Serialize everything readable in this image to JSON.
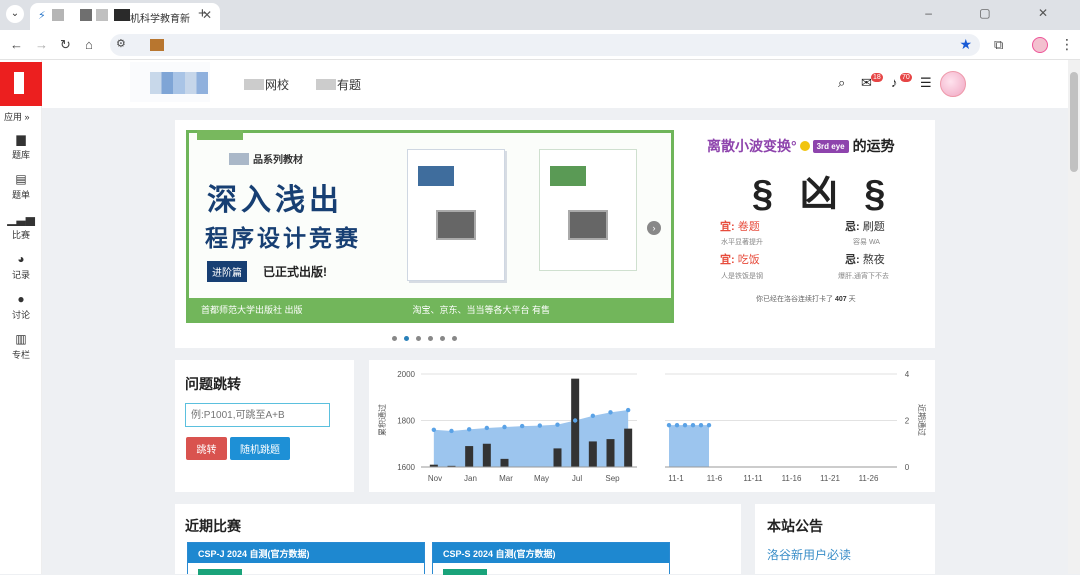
{
  "browser": {
    "tab_title": "机科学教育新",
    "new_tab": "+",
    "window_controls": "– ▢ ✕"
  },
  "sidebar": {
    "apps_label": "应用 »",
    "items": [
      {
        "label": "题库",
        "icon": "book-icon"
      },
      {
        "label": "题单",
        "icon": "clipboard-icon"
      },
      {
        "label": "比赛",
        "icon": "signal-bars-icon"
      },
      {
        "label": "记录",
        "icon": "pie-chart-icon"
      },
      {
        "label": "讨论",
        "icon": "comments-icon"
      },
      {
        "label": "专栏",
        "icon": "columns-book-icon"
      }
    ]
  },
  "header": {
    "nav": [
      {
        "label": "网校"
      },
      {
        "label": "有题"
      }
    ],
    "mail_badge": "18",
    "bell_badge": "70"
  },
  "banner": {
    "series": "品系列教材",
    "headline1": "深入浅出",
    "headline2": "程序设计竞赛",
    "pill": "进阶篇",
    "published": "已正式出版!",
    "footer_left": "首都师范大学出版社 出版",
    "footer_right": "淘宝、京东、当当等各大平台 有售",
    "dots": 6,
    "active_dot": 1
  },
  "fortune": {
    "username": "离散小波变换°",
    "user_tag": "3rd eye",
    "suffix": "的运势",
    "luck": "§ 凶 §",
    "good1_k": "宜:",
    "good1_v": "卷题",
    "good1_s": "水平显著提升",
    "bad1_k": "忌:",
    "bad1_v": "刷题",
    "bad1_s": "容易 WA",
    "good2_k": "宜:",
    "good2_v": "吃饭",
    "good2_s": "人是铁饭是钢",
    "bad2_k": "忌:",
    "bad2_v": "熬夜",
    "bad2_s": "爆肝,通宵下不去",
    "checkin_prefix": "你已经在洛谷连续打卡了",
    "checkin_days": "407",
    "checkin_suffix": "天"
  },
  "jump": {
    "title": "问题跳转",
    "placeholder": "例:P1001,可跳至A+B",
    "jump_btn": "跳转",
    "random_btn": "随机跳题"
  },
  "chart_data": [
    {
      "type": "bar",
      "ylabel": "累积通过",
      "ylim": [
        1600,
        2000
      ],
      "yticks": [
        1600,
        1800,
        2000
      ],
      "xticks": [
        "Nov",
        "Jan",
        "Mar",
        "May",
        "Jul",
        "Sep"
      ],
      "series": [
        {
          "values": [
            1610,
            1605,
            1690,
            1700,
            1635,
            1600,
            1600,
            1680,
            1980,
            1710,
            1720,
            1765
          ]
        },
        {
          "values": [
            1760,
            1755,
            1762,
            1768,
            1772,
            1776,
            1778,
            1782,
            1800,
            1820,
            1835,
            1845
          ]
        }
      ]
    },
    {
      "type": "bar",
      "ylabel": "近期通过",
      "ylim": [
        0,
        4
      ],
      "yticks": [
        0,
        2,
        4
      ],
      "xticks": [
        "11-1",
        "11-6",
        "11-11",
        "11-16",
        "11-21",
        "11-26"
      ],
      "series": [
        {
          "values": [
            1.8,
            1.8,
            1.8,
            1.8,
            1.8,
            1.8
          ]
        }
      ]
    }
  ],
  "contests": {
    "title": "近期比赛",
    "items": [
      {
        "name": "CSP-J 2024 自测(官方数据)"
      },
      {
        "name": "CSP-S 2024 自测(官方数据)"
      }
    ]
  },
  "notice": {
    "title": "本站公告",
    "link": "洛谷新用户必读"
  }
}
